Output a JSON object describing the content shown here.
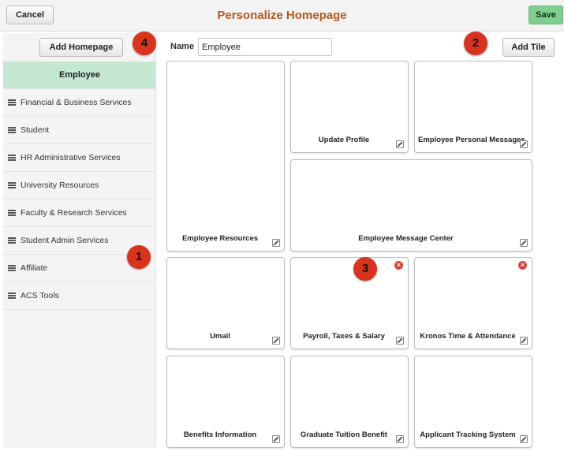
{
  "header": {
    "cancel_label": "Cancel",
    "title": "Personalize Homepage",
    "save_label": "Save"
  },
  "sidebar": {
    "add_homepage_label": "Add Homepage",
    "items": [
      {
        "label": "Employee",
        "active": true
      },
      {
        "label": "Financial & Business Services"
      },
      {
        "label": "Student"
      },
      {
        "label": "HR Administrative Services"
      },
      {
        "label": "University Resources"
      },
      {
        "label": "Faculty & Research Services"
      },
      {
        "label": "Student Admin Services"
      },
      {
        "label": "Affiliate"
      },
      {
        "label": "ACS Tools"
      }
    ]
  },
  "main": {
    "name_label": "Name",
    "name_value": "Employee",
    "add_tile_label": "Add Tile",
    "tiles": [
      {
        "title": "Employee Resources"
      },
      {
        "title": "Update Profile"
      },
      {
        "title": "Employee Personal Messages"
      },
      {
        "title": "Employee Message Center"
      },
      {
        "title": "Umail"
      },
      {
        "title": "Payroll, Taxes & Salary"
      },
      {
        "title": "Kronos Time & Attendance"
      },
      {
        "title": "Benefits Information"
      },
      {
        "title": "Graduate Tuition Benefit"
      },
      {
        "title": "Applicant Tracking System"
      }
    ]
  },
  "callouts": [
    "1",
    "2",
    "3",
    "4"
  ],
  "icons": {
    "drag": "drag-handle-icon",
    "edit": "edit-icon",
    "remove": "remove-icon"
  },
  "colors": {
    "title": "#b4581e",
    "save": "#7ccf8c",
    "active_item": "#c4e8d1",
    "callout": "#d9331d",
    "remove": "#d9413a"
  }
}
